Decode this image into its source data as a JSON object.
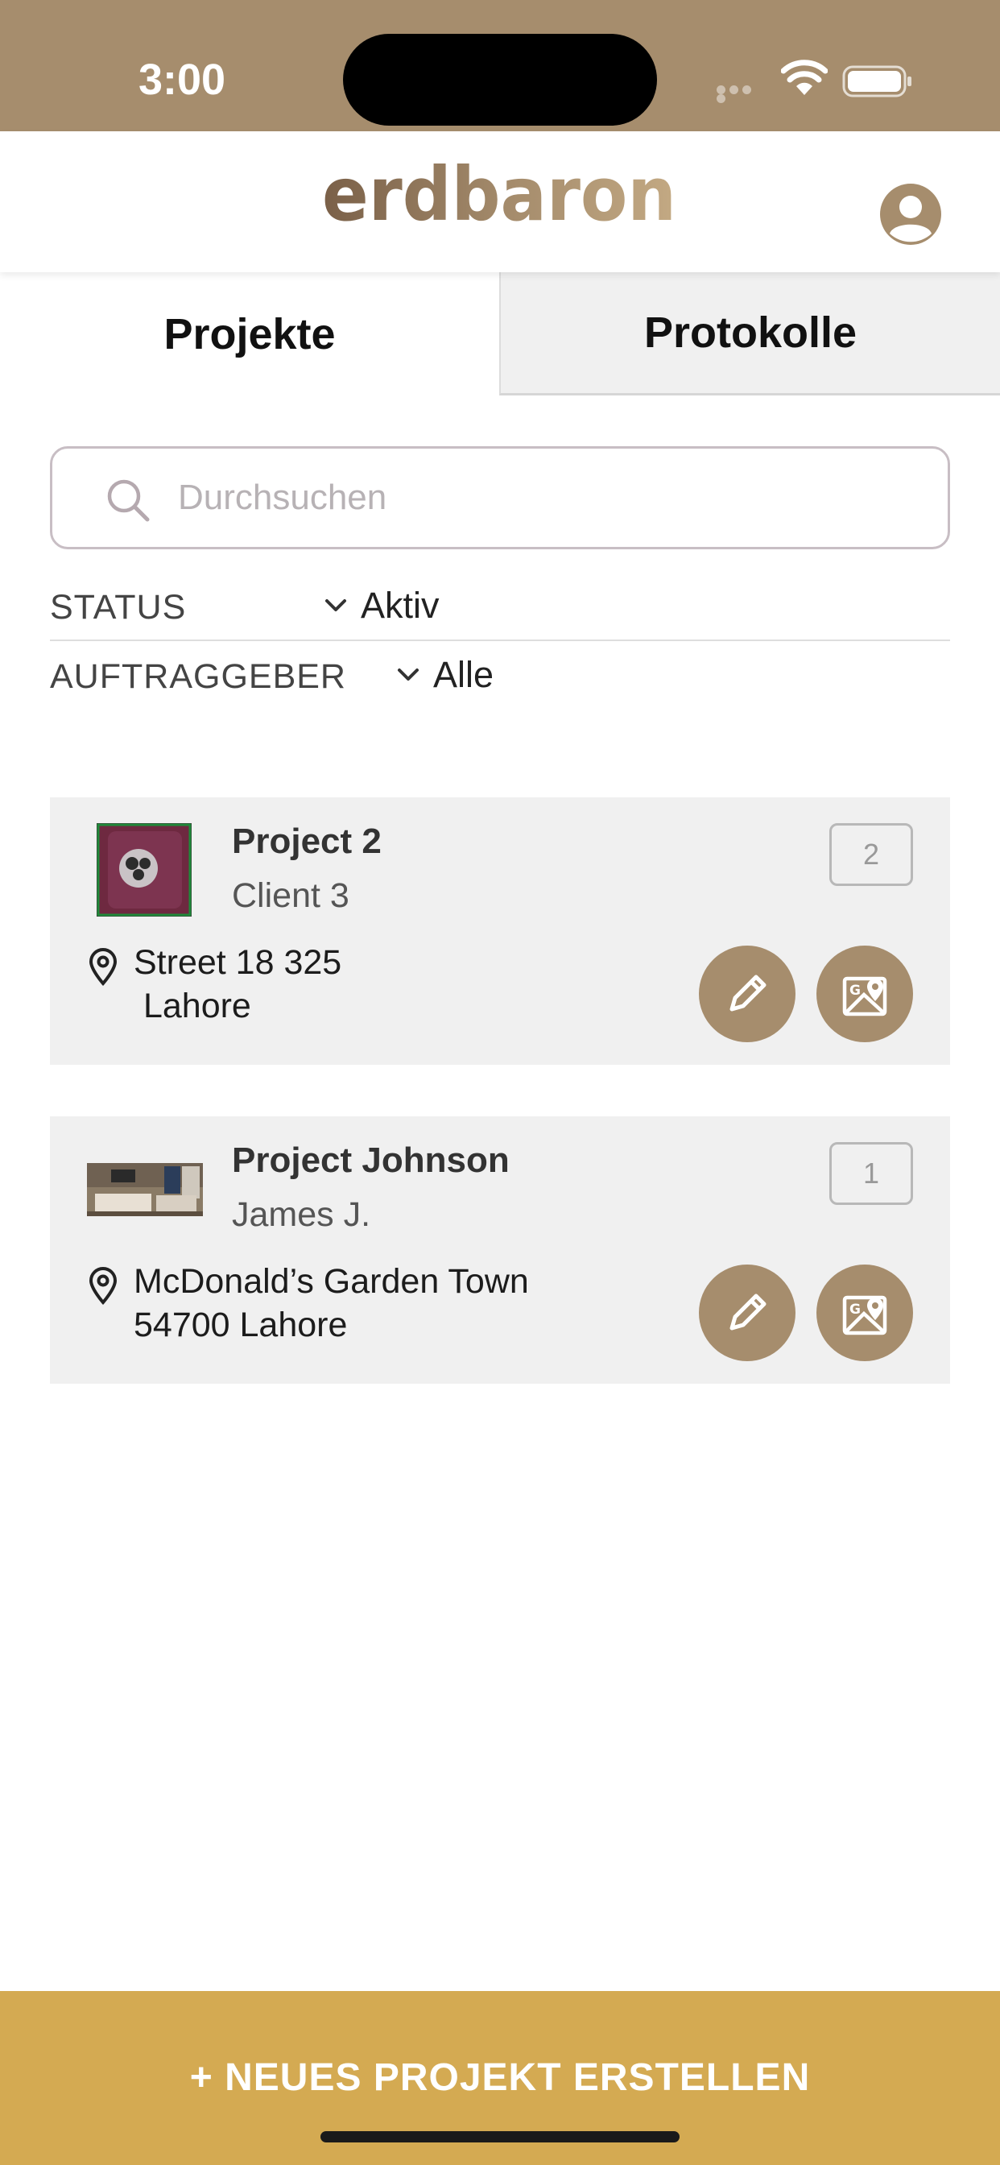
{
  "status_bar": {
    "time": "3:00"
  },
  "header": {
    "logo_text": "erdbaron",
    "avatar_icon": "user-avatar-icon"
  },
  "tabs": [
    {
      "label": "Projekte",
      "active": true
    },
    {
      "label": "Protokolle",
      "active": false
    }
  ],
  "search": {
    "placeholder": "Durchsuchen",
    "value": ""
  },
  "filters": {
    "status": {
      "label": "STATUS",
      "value": "Aktiv"
    },
    "client": {
      "label": "AUFTRAGGEBER",
      "value": "Alle"
    }
  },
  "projects": [
    {
      "title": "Project 2",
      "client": "Client 3",
      "count": "2",
      "address_line1": "Street 18 325",
      "address_line2": " Lahore",
      "thumbnail": "phone-photo"
    },
    {
      "title": "Project Johnson",
      "client": "James J.",
      "count": "1",
      "address_line1": "McDonald’s Garden Town",
      "address_line2": "54700 Lahore",
      "thumbnail": "room-photo"
    }
  ],
  "cta": {
    "label": "+ NEUES PROJEKT ERSTELLEN"
  },
  "colors": {
    "brand": "#a68d6d",
    "cta": "#d4aa52",
    "card_bg": "#f0f0f0"
  }
}
